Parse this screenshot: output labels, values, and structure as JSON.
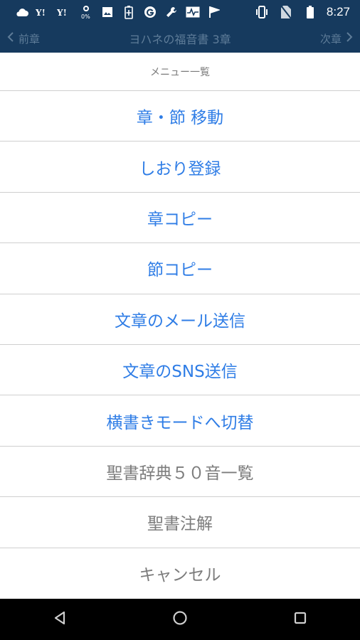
{
  "status_bar": {
    "time": "8:27",
    "icons_left": [
      "weather-cloud-icon",
      "yahoo-icon",
      "yahoo-icon",
      "data-saver-icon",
      "image-icon",
      "battery-saver-icon",
      "g-icon",
      "wrench-icon",
      "pulse-icon",
      "flag-icon"
    ],
    "icons_right": [
      "vibrate-icon",
      "no-sim-icon",
      "battery-icon"
    ],
    "data_saver_label": "0%"
  },
  "nav": {
    "prev_label": "前章",
    "title": "ヨハネの福音書 3章",
    "next_label": "次章"
  },
  "menu": {
    "header": "メニュー一覧",
    "items": [
      {
        "label": "章・節 移動",
        "style": "blue"
      },
      {
        "label": "しおり登録",
        "style": "blue"
      },
      {
        "label": "章コピー",
        "style": "blue"
      },
      {
        "label": "節コピー",
        "style": "blue"
      },
      {
        "label": "文章のメール送信",
        "style": "blue"
      },
      {
        "label": "文章のSNS送信",
        "style": "blue"
      },
      {
        "label": "横書きモードへ切替",
        "style": "blue"
      },
      {
        "label": "聖書辞典５０音一覧",
        "style": "gray"
      },
      {
        "label": "聖書注解",
        "style": "gray"
      },
      {
        "label": "キャンセル",
        "style": "gray"
      }
    ]
  },
  "colors": {
    "bar": "#163a5e",
    "accent": "#2f7de6",
    "muted": "#7c7c7c"
  },
  "bottom_nav": [
    "back-icon",
    "home-icon",
    "recents-icon"
  ]
}
